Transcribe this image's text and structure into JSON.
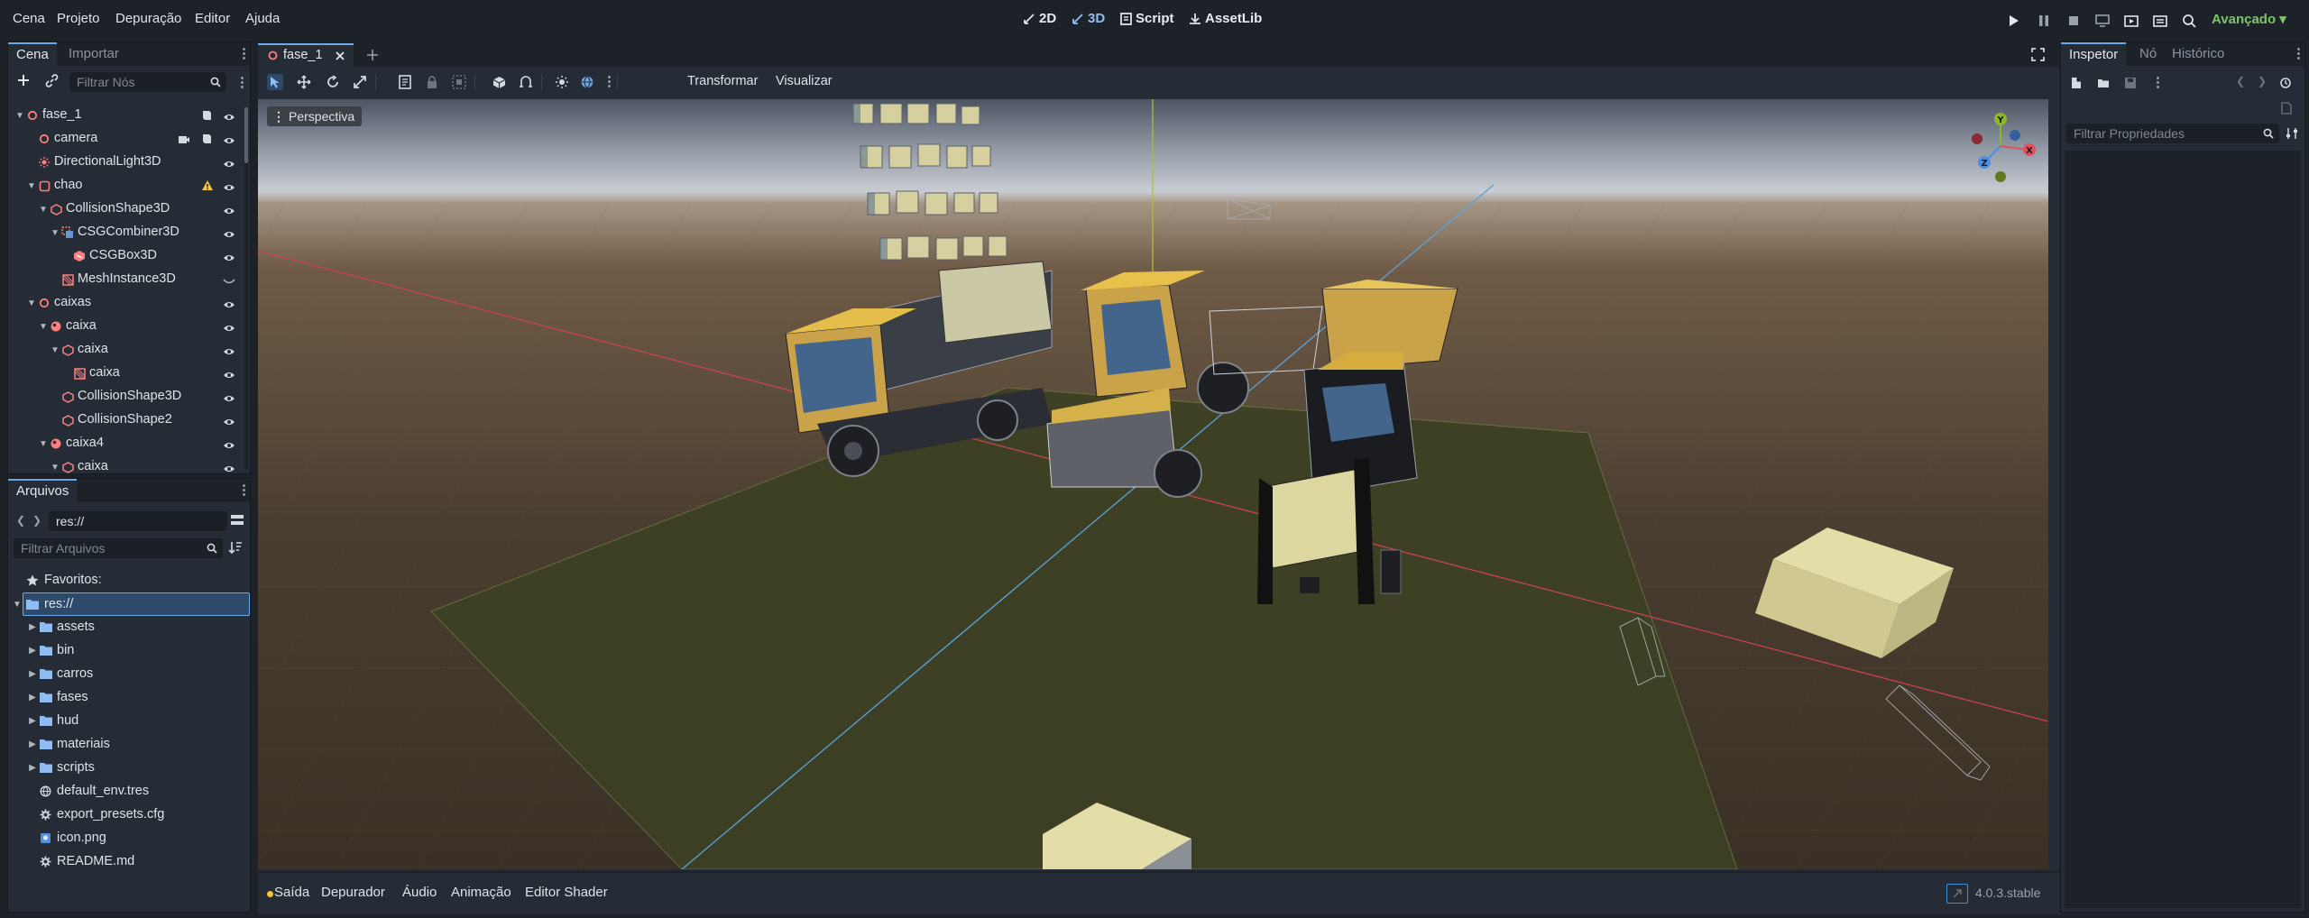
{
  "menubar": {
    "menus": [
      "Cena",
      "Projeto",
      "Depuração",
      "Editor",
      "Ajuda"
    ],
    "main_tabs": [
      "2D",
      "3D",
      "Script",
      "AssetLib"
    ],
    "active_main_tab": "3D",
    "renderer": "Avançado ▾"
  },
  "scene_panel": {
    "tabs": [
      "Cena",
      "Importar"
    ],
    "filter_placeholder": "Filtrar Nós",
    "nodes": [
      {
        "label": "fase_1",
        "depth": 0,
        "expanded": true,
        "icon": "node3d-icon"
      },
      {
        "label": "camera",
        "depth": 1,
        "expanded": null,
        "icon": "node3d-icon"
      },
      {
        "label": "DirectionalLight3D",
        "depth": 1,
        "expanded": null,
        "icon": "directional-light-icon"
      },
      {
        "label": "chao",
        "depth": 1,
        "expanded": true,
        "icon": "static-body-icon",
        "warning": true
      },
      {
        "label": "CollisionShape3D",
        "depth": 2,
        "expanded": true,
        "icon": "collision-shape-icon"
      },
      {
        "label": "CSGCombiner3D",
        "depth": 3,
        "expanded": true,
        "icon": "csg-combiner-icon"
      },
      {
        "label": "CSGBox3D",
        "depth": 4,
        "expanded": null,
        "icon": "csg-box-icon"
      },
      {
        "label": "MeshInstance3D",
        "depth": 3,
        "expanded": null,
        "icon": "mesh-instance-icon"
      },
      {
        "label": "caixas",
        "depth": 1,
        "expanded": true,
        "icon": "node3d-icon"
      },
      {
        "label": "caixa",
        "depth": 2,
        "expanded": true,
        "icon": "rigid-body-icon"
      },
      {
        "label": "caixa",
        "depth": 3,
        "expanded": true,
        "icon": "collision-shape-icon"
      },
      {
        "label": "caixa",
        "depth": 4,
        "expanded": null,
        "icon": "mesh-instance-icon"
      },
      {
        "label": "CollisionShape3D",
        "depth": 3,
        "expanded": null,
        "icon": "collision-shape-icon"
      },
      {
        "label": "CollisionShape2",
        "depth": 3,
        "expanded": null,
        "icon": "collision-shape-icon"
      },
      {
        "label": "caixa4",
        "depth": 2,
        "expanded": true,
        "icon": "rigid-body-icon"
      },
      {
        "label": "caixa",
        "depth": 3,
        "expanded": true,
        "icon": "collision-shape-icon"
      }
    ]
  },
  "files_panel": {
    "tab": "Arquivos",
    "path": "res://",
    "filter_placeholder": "Filtrar Arquivos",
    "favorites_label": "Favoritos:",
    "root_label": "res://",
    "items": [
      {
        "label": "assets",
        "type": "folder"
      },
      {
        "label": "bin",
        "type": "folder"
      },
      {
        "label": "carros",
        "type": "folder"
      },
      {
        "label": "fases",
        "type": "folder"
      },
      {
        "label": "hud",
        "type": "folder"
      },
      {
        "label": "materiais",
        "type": "folder"
      },
      {
        "label": "scripts",
        "type": "folder"
      },
      {
        "label": "default_env.tres",
        "type": "resource"
      },
      {
        "label": "export_presets.cfg",
        "type": "config"
      },
      {
        "label": "icon.png",
        "type": "image"
      },
      {
        "label": "README.md",
        "type": "config"
      }
    ]
  },
  "editor": {
    "scene_tab": "fase_1",
    "toolbar_menus": [
      "Transformar",
      "Visualizar"
    ],
    "viewport_label": "Perspectiva",
    "gizmo_axes": [
      "Y",
      "X",
      "Z"
    ]
  },
  "bottom_panel": {
    "tabs": [
      "Saída",
      "Depurador",
      "Áudio",
      "Animação",
      "Editor Shader"
    ],
    "version": "4.0.3.stable"
  },
  "inspector": {
    "tabs": [
      "Inspetor",
      "Nó",
      "Histórico"
    ],
    "filter_placeholder": "Filtrar Propriedades"
  },
  "colors": {
    "accent": "#6ea8ea",
    "node_red": "#fc7f7f",
    "warning": "#f5c542",
    "renderer_green": "#7ec46a",
    "folder_blue": "#8fbdf3"
  }
}
